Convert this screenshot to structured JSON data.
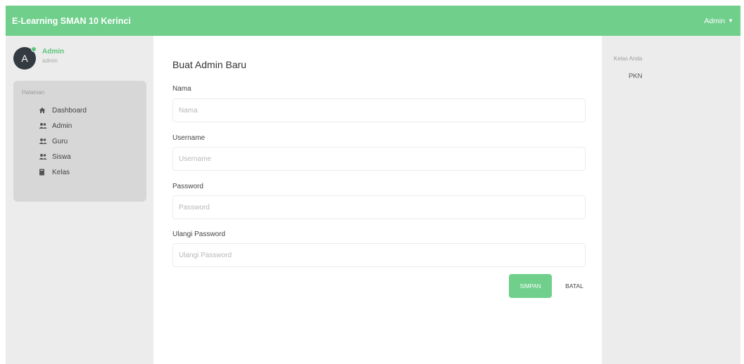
{
  "navbar": {
    "brand": "E-Learning SMAN 10 Kerinci",
    "user_label": "Admin",
    "caret": "▼"
  },
  "sidebar": {
    "profile": {
      "initial": "A",
      "name": "Admin",
      "role": "admin"
    },
    "menu_title": "Halaman",
    "items": [
      {
        "label": "Dashboard",
        "icon": "home-icon"
      },
      {
        "label": "Admin",
        "icon": "users-icon"
      },
      {
        "label": "Guru",
        "icon": "users-icon"
      },
      {
        "label": "Siswa",
        "icon": "users-icon"
      },
      {
        "label": "Kelas",
        "icon": "book-icon"
      }
    ]
  },
  "form": {
    "title": "Buat Admin Baru",
    "fields": [
      {
        "label": "Nama",
        "placeholder": "Nama",
        "value": ""
      },
      {
        "label": "Username",
        "placeholder": "Username",
        "value": ""
      },
      {
        "label": "Password",
        "placeholder": "Password",
        "value": ""
      },
      {
        "label": "Ulangi Password",
        "placeholder": "Ulangi Password",
        "value": ""
      }
    ],
    "submit_label": "SIMPAN",
    "cancel_label": "BATAL"
  },
  "right_panel": {
    "title": "Kelas Anda",
    "classes": [
      "PKN"
    ]
  },
  "colors": {
    "primary": "#6fcf8b",
    "background": "#ececec",
    "menu_panel": "#d7d7d7",
    "avatar": "#333a42",
    "status_online": "#5cc47c"
  }
}
